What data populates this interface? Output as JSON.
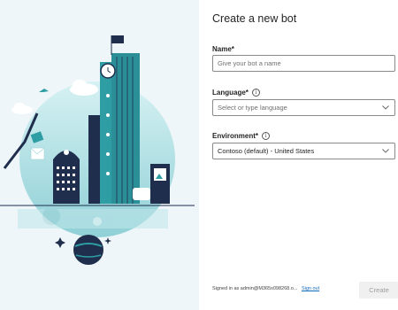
{
  "dialog": {
    "title": "Create a new bot",
    "name_label": "Name*",
    "name_placeholder": "Give your bot a name",
    "language_label": "Language*",
    "language_placeholder": "Select or type language",
    "environment_label": "Environment*",
    "environment_value": "Contoso (default) - United States"
  },
  "footer": {
    "signed_in_text": "Signed in as admin@M365x098268.o...",
    "sign_out_label": "Sign out",
    "create_label": "Create"
  },
  "illustration": {
    "icon": "city-illustration",
    "colors": {
      "teal": "#2f9ea4",
      "dark_navy": "#1f2e4d",
      "light_teal": "#bfe6ea",
      "background": "#eef6f9"
    }
  }
}
